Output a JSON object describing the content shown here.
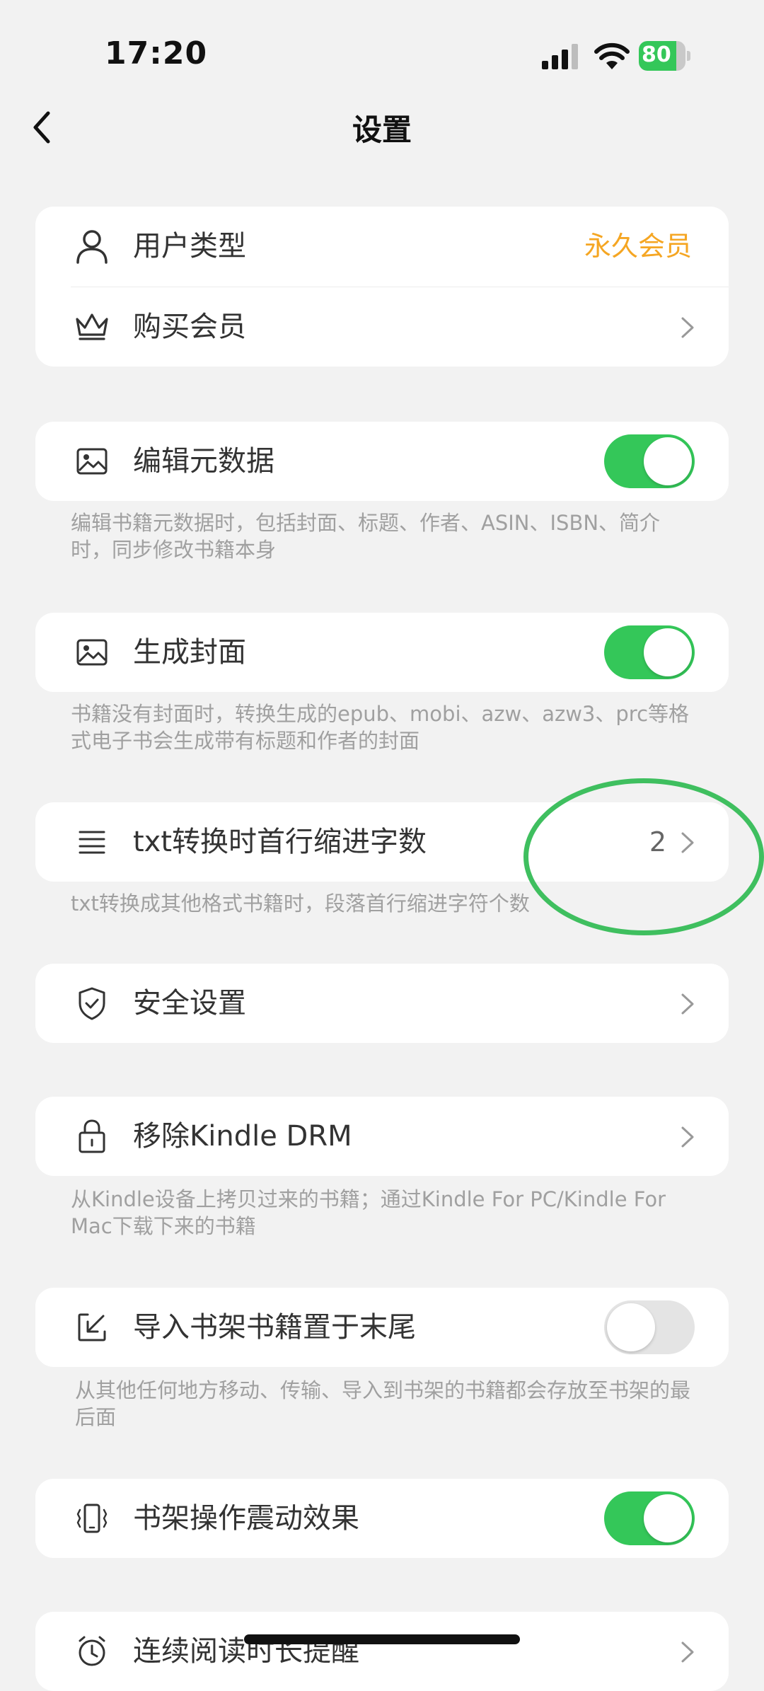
{
  "status_bar": {
    "time": "17:20",
    "battery": "80",
    "battery_level": 0.8
  },
  "header": {
    "title": "设置"
  },
  "colors": {
    "accent_green": "#34c759",
    "member_orange": "#f5a623",
    "annotation_green": "#3fbf5f"
  },
  "rows": {
    "user_type": {
      "label": "用户类型",
      "value": "永久会员",
      "icon": "user-icon"
    },
    "buy_member": {
      "label": "购买会员",
      "icon": "crown-icon"
    },
    "edit_metadata": {
      "label": "编辑元数据",
      "icon": "image-icon",
      "enabled": true,
      "desc": "编辑书籍元数据时，包括封面、标题、作者、ASIN、ISBN、简介时，同步修改书籍本身"
    },
    "gen_cover": {
      "label": "生成封面",
      "icon": "image-icon",
      "enabled": true,
      "desc": "书籍没有封面时，转换生成的epub、mobi、azw、azw3、prc等格式电子书会生成带有标题和作者的封面"
    },
    "txt_indent": {
      "label": "txt转换时首行缩进字数",
      "icon": "list-icon",
      "value": "2",
      "desc": "txt转换成其他格式书籍时，段落首行缩进字符个数"
    },
    "security": {
      "label": "安全设置",
      "icon": "shield-icon"
    },
    "remove_drm": {
      "label": "移除Kindle DRM",
      "icon": "lock-icon",
      "desc": "从Kindle设备上拷贝过来的书籍；通过Kindle For PC/Kindle For Mac下载下来的书籍"
    },
    "import_end": {
      "label": "导入书架书籍置于末尾",
      "icon": "import-icon",
      "enabled": false,
      "desc": "从其他任何地方移动、传输、导入到书架的书籍都会存放至书架的最后面"
    },
    "vibration": {
      "label": "书架操作震动效果",
      "icon": "vibrate-icon",
      "enabled": true
    },
    "reading_reminder": {
      "label": "连续阅读时长提醒",
      "icon": "alarm-icon"
    }
  }
}
